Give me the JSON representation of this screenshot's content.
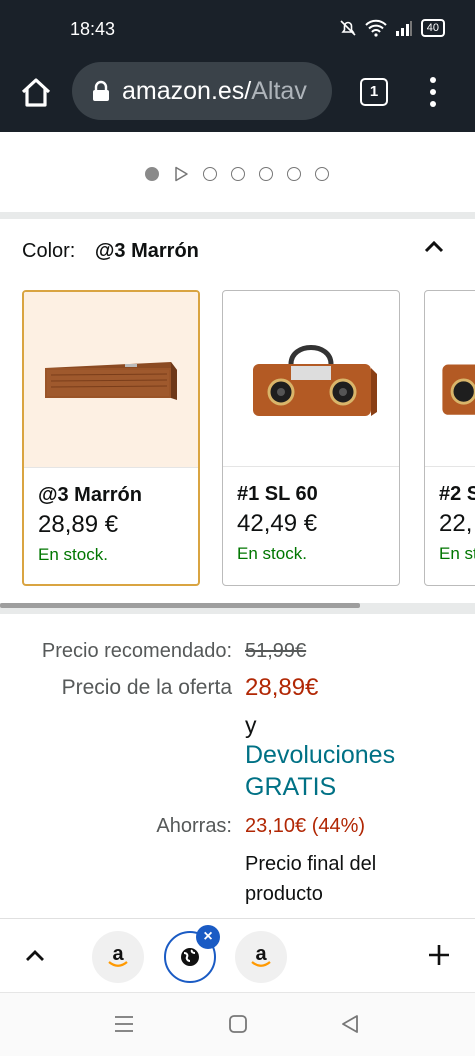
{
  "status_bar": {
    "time": "18:43",
    "battery": "40"
  },
  "browser": {
    "url_host": "amazon.es/",
    "url_path": "Altav",
    "tab_count": "1"
  },
  "carousel": {
    "active_index": 0,
    "dot_count": 7
  },
  "color_selector": {
    "label": "Color:",
    "selected": "@3 Marrón",
    "variants": [
      {
        "name": "@3 Marrón",
        "price": "28,89 €",
        "stock": "En stock."
      },
      {
        "name": "#1 SL 60",
        "price": "42,49 €",
        "stock": "En stock."
      },
      {
        "name": "#2 S",
        "price": "22,",
        "stock": "En st"
      }
    ]
  },
  "pricing": {
    "recommended_label": "Precio recomendado:",
    "recommended_value": "51,99€",
    "offer_label": "Precio de la oferta",
    "offer_value": "28,89€",
    "and_text": "y",
    "returns_line1": "Devoluciones",
    "returns_line2": "GRATIS",
    "savings_label": "Ahorras:",
    "savings_value": "23,10€ (44%)",
    "final_line1": "Precio final del",
    "final_line2": "producto"
  },
  "tab_strip": {
    "tabs": [
      {
        "icon": "amazon-logo-icon",
        "letter": "a"
      },
      {
        "icon": "globe-icon"
      },
      {
        "icon": "amazon-logo-icon",
        "letter": "a"
      }
    ]
  },
  "colors": {
    "accent_blue": "#1a5bc4",
    "price_red": "#b12704",
    "stock_green": "#007600",
    "link_teal": "#007185"
  }
}
